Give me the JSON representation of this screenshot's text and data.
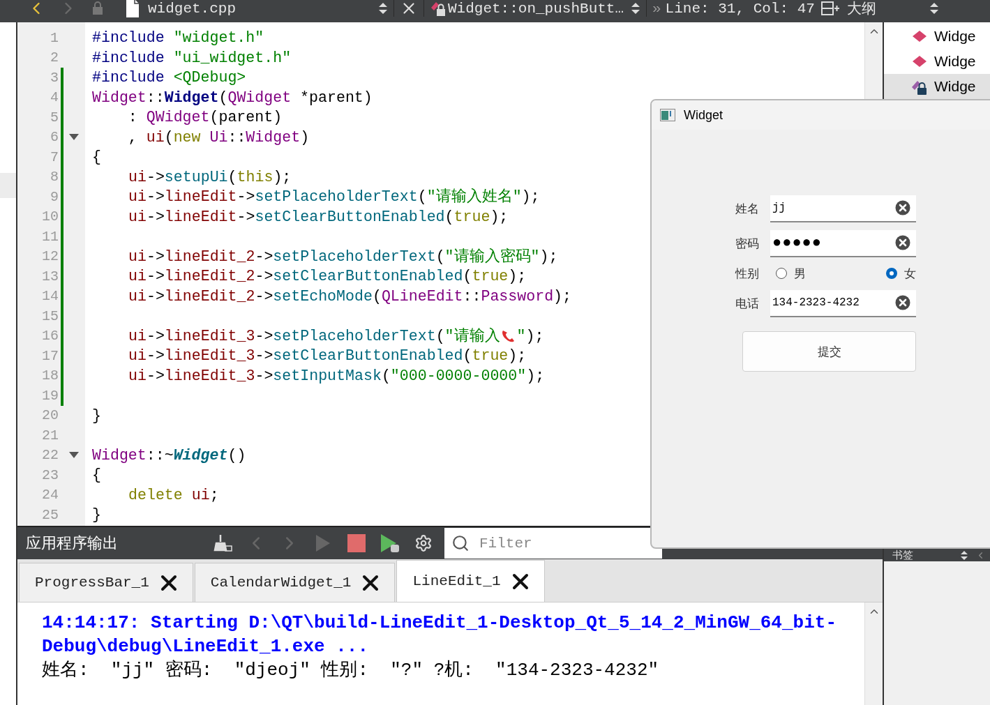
{
  "toolbar": {
    "file": "widget.cpp",
    "symbol": "Widget::on_pushButt…",
    "more": "»",
    "position": "Line: 31, Col: 47"
  },
  "outline": {
    "title": "大纲",
    "items": [
      {
        "label": "Widge",
        "kind": "function",
        "selected": false
      },
      {
        "label": "Widge",
        "kind": "function",
        "selected": false
      },
      {
        "label": "Widge",
        "kind": "locked",
        "selected": true
      }
    ]
  },
  "editor": {
    "lines": [
      {
        "number": "1",
        "changed": false,
        "foldable": false,
        "tokens": [
          {
            "kind": "pre",
            "text": "#include "
          },
          {
            "kind": "string",
            "text": "\"widget.h\""
          }
        ]
      },
      {
        "number": "2",
        "changed": false,
        "foldable": false,
        "tokens": [
          {
            "kind": "pre",
            "text": "#include "
          },
          {
            "kind": "string",
            "text": "\"ui_widget.h\""
          }
        ]
      },
      {
        "number": "3",
        "changed": true,
        "foldable": false,
        "tokens": [
          {
            "kind": "pre",
            "text": "#include "
          },
          {
            "kind": "string",
            "text": "<QDebug>"
          }
        ]
      },
      {
        "number": "4",
        "changed": true,
        "foldable": false,
        "tokens": [
          {
            "kind": "type",
            "text": "Widget"
          },
          {
            "kind": "plain",
            "text": "::"
          },
          {
            "kind": "decl",
            "text": "Widget"
          },
          {
            "kind": "plain",
            "text": "("
          },
          {
            "kind": "type",
            "text": "QWidget"
          },
          {
            "kind": "plain",
            "text": " *parent)"
          }
        ]
      },
      {
        "number": "5",
        "changed": true,
        "foldable": false,
        "tokens": [
          {
            "kind": "plain",
            "text": "    : "
          },
          {
            "kind": "type",
            "text": "QWidget"
          },
          {
            "kind": "plain",
            "text": "(parent)"
          }
        ]
      },
      {
        "number": "6",
        "changed": true,
        "foldable": true,
        "tokens": [
          {
            "kind": "plain",
            "text": "    , "
          },
          {
            "kind": "field",
            "text": "ui"
          },
          {
            "kind": "plain",
            "text": "("
          },
          {
            "kind": "keyword",
            "text": "new"
          },
          {
            "kind": "type",
            "text": " Ui"
          },
          {
            "kind": "plain",
            "text": "::"
          },
          {
            "kind": "type",
            "text": "Widget"
          },
          {
            "kind": "plain",
            "text": ")"
          }
        ]
      },
      {
        "number": "7",
        "changed": true,
        "foldable": false,
        "tokens": [
          {
            "kind": "plain",
            "text": "{"
          }
        ]
      },
      {
        "number": "8",
        "changed": true,
        "foldable": false,
        "indented": true,
        "tokens": [
          {
            "kind": "field",
            "text": "ui"
          },
          {
            "kind": "plain",
            "text": "->"
          },
          {
            "kind": "func",
            "text": "setupUi"
          },
          {
            "kind": "plain",
            "text": "("
          },
          {
            "kind": "keyword",
            "text": "this"
          },
          {
            "kind": "plain",
            "text": ");"
          }
        ]
      },
      {
        "number": "9",
        "changed": true,
        "foldable": false,
        "indented": true,
        "tokens": [
          {
            "kind": "field",
            "text": "ui"
          },
          {
            "kind": "plain",
            "text": "->"
          },
          {
            "kind": "field",
            "text": "lineEdit"
          },
          {
            "kind": "plain",
            "text": "->"
          },
          {
            "kind": "func",
            "text": "setPlaceholderText"
          },
          {
            "kind": "plain",
            "text": "("
          },
          {
            "kind": "string",
            "text": "\"请输入姓名\""
          },
          {
            "kind": "plain",
            "text": ");"
          }
        ]
      },
      {
        "number": "10",
        "changed": true,
        "foldable": false,
        "indented": true,
        "tokens": [
          {
            "kind": "field",
            "text": "ui"
          },
          {
            "kind": "plain",
            "text": "->"
          },
          {
            "kind": "field",
            "text": "lineEdit"
          },
          {
            "kind": "plain",
            "text": "->"
          },
          {
            "kind": "func",
            "text": "setClearButtonEnabled"
          },
          {
            "kind": "plain",
            "text": "("
          },
          {
            "kind": "keyword",
            "text": "true"
          },
          {
            "kind": "plain",
            "text": ");"
          }
        ]
      },
      {
        "number": "11",
        "changed": true,
        "foldable": false
      },
      {
        "number": "12",
        "changed": true,
        "foldable": false,
        "indented": true,
        "tokens": [
          {
            "kind": "field",
            "text": "ui"
          },
          {
            "kind": "plain",
            "text": "->"
          },
          {
            "kind": "field",
            "text": "lineEdit_2"
          },
          {
            "kind": "plain",
            "text": "->"
          },
          {
            "kind": "func",
            "text": "setPlaceholderText"
          },
          {
            "kind": "plain",
            "text": "("
          },
          {
            "kind": "string",
            "text": "\"请输入密码\""
          },
          {
            "kind": "plain",
            "text": ");"
          }
        ]
      },
      {
        "number": "13",
        "changed": true,
        "foldable": false,
        "indented": true,
        "tokens": [
          {
            "kind": "field",
            "text": "ui"
          },
          {
            "kind": "plain",
            "text": "->"
          },
          {
            "kind": "field",
            "text": "lineEdit_2"
          },
          {
            "kind": "plain",
            "text": "->"
          },
          {
            "kind": "func",
            "text": "setClearButtonEnabled"
          },
          {
            "kind": "plain",
            "text": "("
          },
          {
            "kind": "keyword",
            "text": "true"
          },
          {
            "kind": "plain",
            "text": ");"
          }
        ]
      },
      {
        "number": "14",
        "changed": true,
        "foldable": false,
        "indented": true,
        "tokens": [
          {
            "kind": "field",
            "text": "ui"
          },
          {
            "kind": "plain",
            "text": "->"
          },
          {
            "kind": "field",
            "text": "lineEdit_2"
          },
          {
            "kind": "plain",
            "text": "->"
          },
          {
            "kind": "func",
            "text": "setEchoMode"
          },
          {
            "kind": "plain",
            "text": "("
          },
          {
            "kind": "type",
            "text": "QLineEdit"
          },
          {
            "kind": "plain",
            "text": "::"
          },
          {
            "kind": "type",
            "text": "Password"
          },
          {
            "kind": "plain",
            "text": ");"
          }
        ]
      },
      {
        "number": "15",
        "changed": true,
        "foldable": false
      },
      {
        "number": "16",
        "changed": true,
        "foldable": false,
        "indented": true,
        "tokens": [
          {
            "kind": "field",
            "text": "ui"
          },
          {
            "kind": "plain",
            "text": "->"
          },
          {
            "kind": "field",
            "text": "lineEdit_3"
          },
          {
            "kind": "plain",
            "text": "->"
          },
          {
            "kind": "func",
            "text": "setPlaceholderText"
          },
          {
            "kind": "plain",
            "text": "("
          },
          {
            "kind": "string",
            "text": "\"请输入"
          },
          {
            "kind": "phone"
          },
          {
            "kind": "string",
            "text": "\""
          },
          {
            "kind": "plain",
            "text": ");"
          }
        ]
      },
      {
        "number": "17",
        "changed": true,
        "foldable": false,
        "indented": true,
        "tokens": [
          {
            "kind": "field",
            "text": "ui"
          },
          {
            "kind": "plain",
            "text": "->"
          },
          {
            "kind": "field",
            "text": "lineEdit_3"
          },
          {
            "kind": "plain",
            "text": "->"
          },
          {
            "kind": "func",
            "text": "setClearButtonEnabled"
          },
          {
            "kind": "plain",
            "text": "("
          },
          {
            "kind": "keyword",
            "text": "true"
          },
          {
            "kind": "plain",
            "text": ");"
          }
        ]
      },
      {
        "number": "18",
        "changed": true,
        "foldable": false,
        "indented": true,
        "tokens": [
          {
            "kind": "field",
            "text": "ui"
          },
          {
            "kind": "plain",
            "text": "->"
          },
          {
            "kind": "field",
            "text": "lineEdit_3"
          },
          {
            "kind": "plain",
            "text": "->"
          },
          {
            "kind": "func",
            "text": "setInputMask"
          },
          {
            "kind": "plain",
            "text": "("
          },
          {
            "kind": "string",
            "text": "\"000-0000-0000\""
          },
          {
            "kind": "plain",
            "text": ");"
          }
        ]
      },
      {
        "number": "19",
        "changed": true,
        "foldable": false
      },
      {
        "number": "20",
        "changed": false,
        "foldable": false,
        "tokens": [
          {
            "kind": "plain",
            "text": "}"
          }
        ]
      },
      {
        "number": "21",
        "changed": false,
        "foldable": false
      },
      {
        "number": "22",
        "changed": false,
        "foldable": true,
        "tokens": [
          {
            "kind": "type",
            "text": "Widget"
          },
          {
            "kind": "plain",
            "text": "::~"
          },
          {
            "kind": "decl-italic",
            "text": "Widget"
          },
          {
            "kind": "plain",
            "text": "()"
          }
        ]
      },
      {
        "number": "23",
        "changed": false,
        "foldable": false,
        "tokens": [
          {
            "kind": "plain",
            "text": "{"
          }
        ]
      },
      {
        "number": "24",
        "changed": false,
        "foldable": false,
        "indented": true,
        "tokens": [
          {
            "kind": "keyword",
            "text": "delete"
          },
          {
            "kind": "field",
            "text": " ui"
          },
          {
            "kind": "plain",
            "text": ";"
          }
        ]
      },
      {
        "number": "25",
        "changed": false,
        "foldable": false,
        "tokens": [
          {
            "kind": "plain",
            "text": "}"
          }
        ]
      }
    ]
  },
  "output_pane": {
    "title": "应用程序输出",
    "filter_placeholder": "Filter",
    "tabs": [
      {
        "label": "ProgressBar_1",
        "selected": false
      },
      {
        "label": "CalendarWidget_1",
        "selected": false
      },
      {
        "label": "LineEdit_1",
        "selected": true
      }
    ],
    "lines": [
      {
        "kind": "info",
        "text": "14:14:17: Starting D:\\QT\\build-LineEdit_1-Desktop_Qt_5_14_2_MinGW_64_bit-Debug\\debug\\LineEdit_1.exe ..."
      },
      {
        "kind": "plain",
        "text": "姓名:  \"jj\" 密码:  \"djeoj\" 性别:  \"?\" ?机:  \"134-2323-4232\""
      }
    ]
  },
  "bookmarks": {
    "title": "书签"
  },
  "dialog": {
    "title": "Widget",
    "submit": "提交",
    "fields": [
      {
        "kind": "text",
        "label": "姓名",
        "value": "jj"
      },
      {
        "kind": "password",
        "label": "密码",
        "value": "●●●●●"
      },
      {
        "kind": "radio",
        "label": "性别",
        "options": [
          {
            "label": "男",
            "selected": false
          },
          {
            "label": "女",
            "selected": true
          }
        ]
      },
      {
        "kind": "text",
        "label": "电话",
        "value": "134-2323-4232"
      }
    ]
  }
}
